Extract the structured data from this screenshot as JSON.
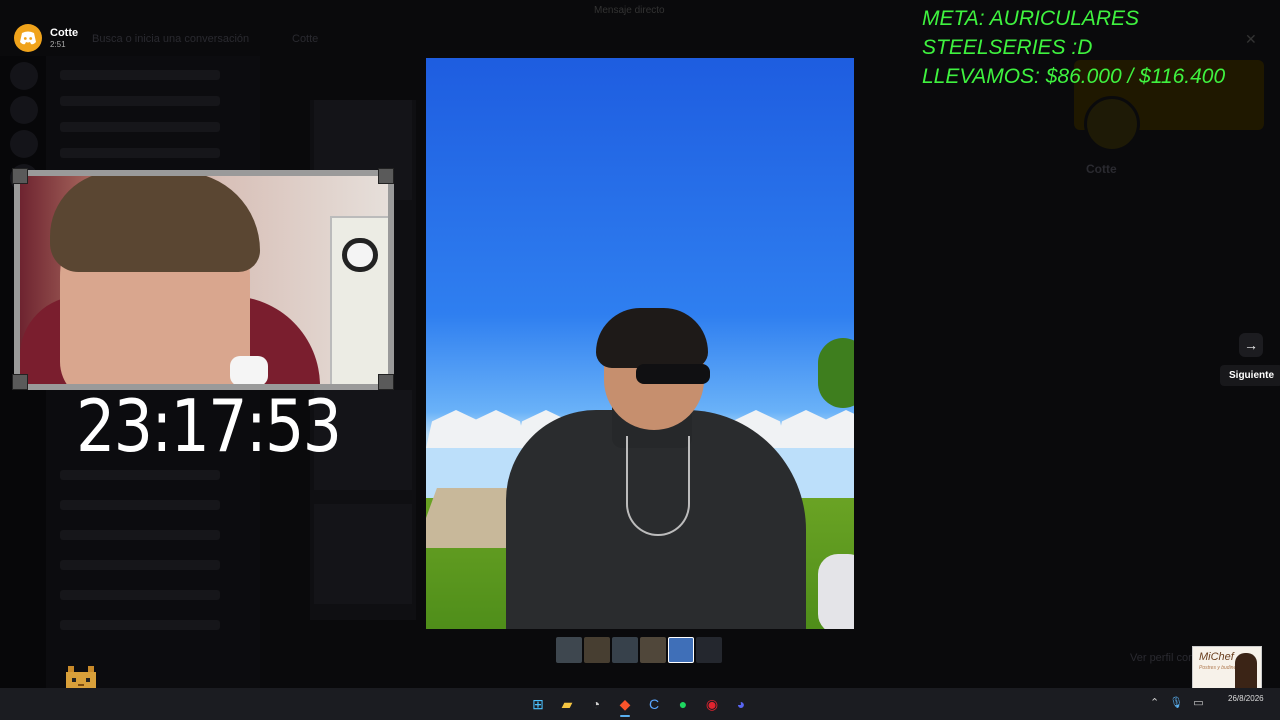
{
  "discord": {
    "user_name": "Cotte",
    "duration": "2:51",
    "channel_label": "Cotte",
    "search_placeholder": "Busca o inicia una conversación",
    "top_title": "Mensaje directo"
  },
  "overlay": {
    "meta_line1": "META: AURICULARES STEELSERIES :D",
    "meta_line2": "LLEVAMOS: $86.000 / $116.400",
    "meta_color": "#3ff23f"
  },
  "stream_timer": "23:17:53",
  "viewer": {
    "next_tooltip": "Siguiente",
    "thumbnail_count": 6,
    "active_thumbnail_index": 4,
    "thumb_colors": [
      "#6a7a86",
      "#7a6a50",
      "#5d6f80",
      "#8a7a60",
      "#3f6fb8",
      "#3b3f4a"
    ]
  },
  "profile_panel": {
    "name": "Cotte",
    "status_text": "Ver perfil completo"
  },
  "brand": {
    "name": "MiChef",
    "tagline": "Postres y budines"
  },
  "taskbar": {
    "apps": [
      {
        "name": "windows-start-icon",
        "glyph": "⊞",
        "color": "#4cc2ff"
      },
      {
        "name": "file-explorer-icon",
        "glyph": "▰",
        "color": "#f5c542"
      },
      {
        "name": "clock-app-icon",
        "glyph": "◔",
        "color": "#cfcfcf"
      },
      {
        "name": "brave-browser-icon",
        "glyph": "◆",
        "color": "#fb542b"
      },
      {
        "name": "c-app-icon",
        "glyph": "C",
        "color": "#5aa6ff"
      },
      {
        "name": "spotify-icon",
        "glyph": "●",
        "color": "#1ed760"
      },
      {
        "name": "opera-icon",
        "glyph": "◉",
        "color": "#e0242f"
      },
      {
        "name": "discord-icon",
        "glyph": "◕",
        "color": "#5865f2"
      }
    ],
    "active_app": "brave-browser-icon",
    "date": "26/8/2026"
  }
}
